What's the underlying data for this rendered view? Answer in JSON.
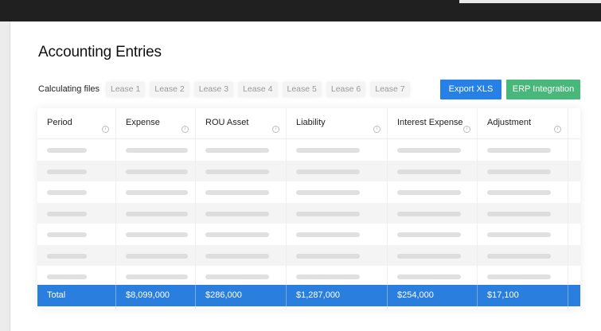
{
  "page": {
    "title": "Accounting Entries",
    "calculating_label": "Calculating files"
  },
  "tabs": [
    "Lease 1",
    "Lease 2",
    "Lease 3",
    "Lease 4",
    "Lease 5",
    "Lease 6",
    "Lease 7"
  ],
  "actions": {
    "export_label": "Export XLS",
    "erp_label": "ERP Integration"
  },
  "table": {
    "columns": [
      "Period",
      "Expense",
      "ROU Asset",
      "Liability",
      "Interest Expense",
      "Adjustment"
    ],
    "info_glyph": "i",
    "loading_rows": 7,
    "totals": [
      "Total",
      "$8,099,000",
      "$286,000",
      "$1,287,000",
      "$254,000",
      "$17,100"
    ]
  },
  "colors": {
    "topbar": "#1f201f",
    "export_button": "#2680e6",
    "erp_button": "#47b87a",
    "total_row": "#2a7fde",
    "skeleton": "#e0e0e0"
  },
  "icons": [
    "info-icon"
  ]
}
